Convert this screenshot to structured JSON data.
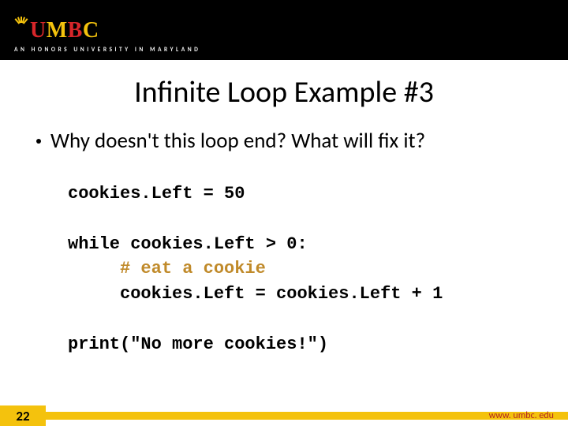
{
  "header": {
    "logo_letters": {
      "u": "U",
      "m": "M",
      "b": "B",
      "c": "C"
    },
    "tagline": "AN HONORS UNIVERSITY IN MARYLAND"
  },
  "title": "Infinite Loop Example #3",
  "bullet": "Why doesn't this loop end?  What will fix it?",
  "code": {
    "l1": "cookies.Left = 50",
    "l2": "",
    "l3": "while cookies.Left > 0:",
    "l4": "     # eat a cookie",
    "l5": "     cookies.Left = cookies.Left + 1",
    "l6": "",
    "l7": "print(\"No more cookies!\")"
  },
  "footer": {
    "slide_number": "22",
    "url": "www. umbc. edu"
  }
}
